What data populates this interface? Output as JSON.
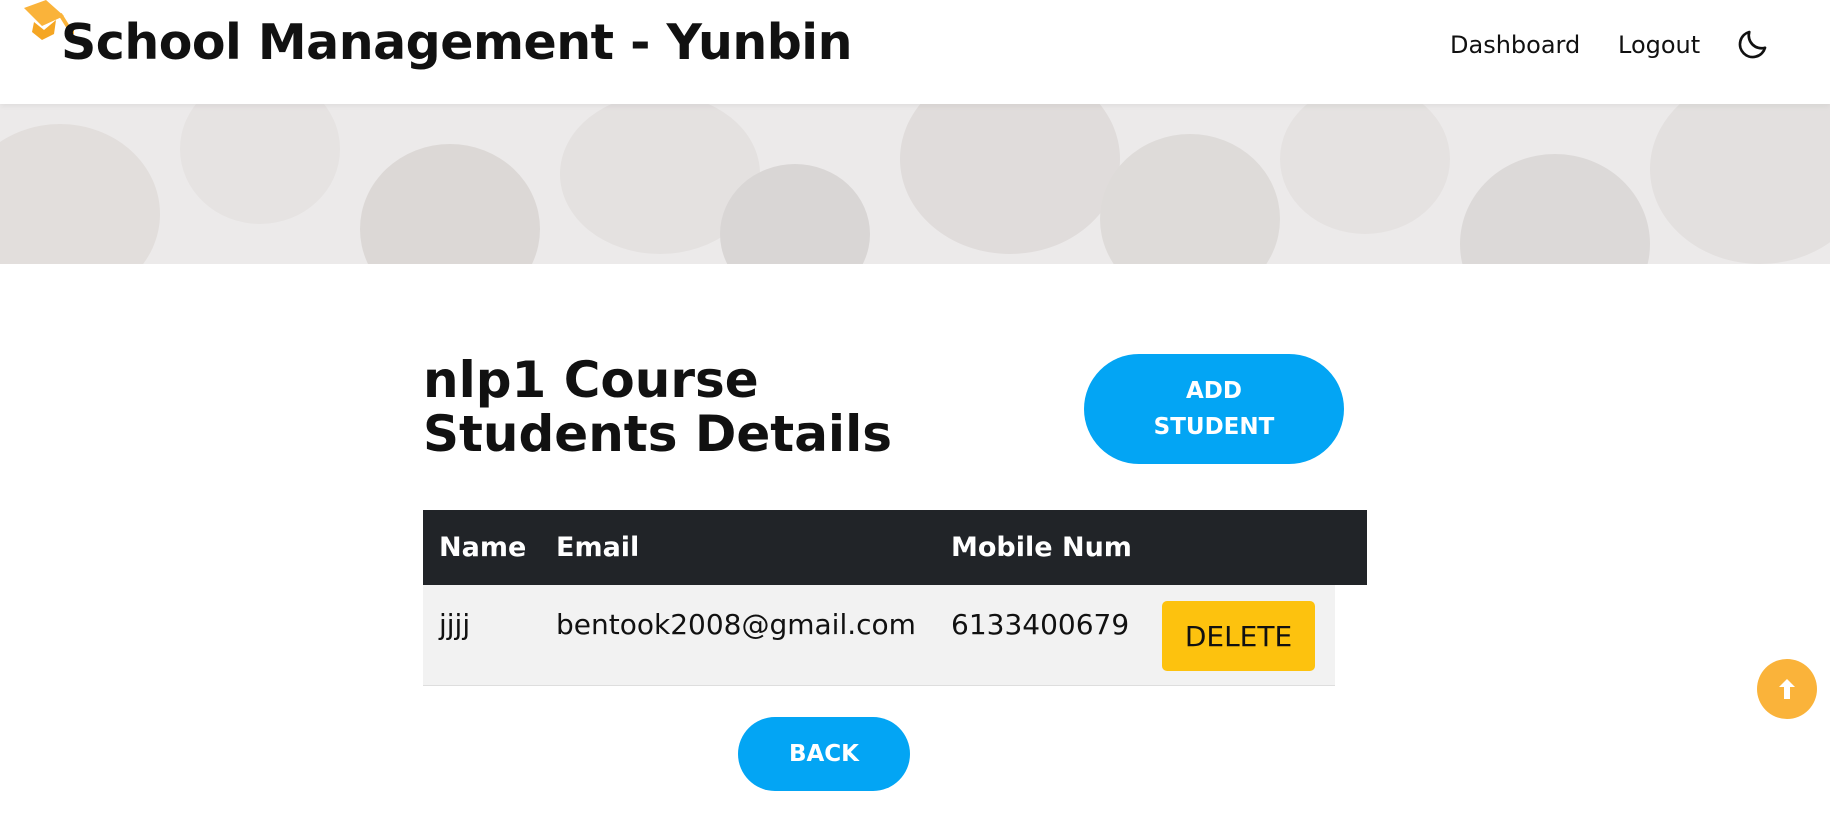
{
  "header": {
    "brand": "School Management - Yunbin",
    "nav": {
      "dashboard": "Dashboard",
      "logout": "Logout"
    },
    "icons": {
      "logo": "graduation-cap-icon",
      "theme": "moon-icon"
    }
  },
  "main": {
    "title": "nlp1 Course Students Details",
    "add_button": "ADD STUDENT",
    "back_button": "BACK",
    "table": {
      "columns": [
        "Name",
        "Email",
        "Mobile Num"
      ],
      "rows": [
        {
          "name": "jjjj",
          "email": "bentook2008@gmail.com",
          "mobile": "6133400679",
          "action": "DELETE"
        }
      ]
    }
  },
  "scroll_top": {
    "icon": "arrow-up-icon"
  },
  "colors": {
    "accent": "#03a5f4",
    "delete": "#fdc20e",
    "logo": "#fab33a",
    "table_header": "#212428"
  }
}
